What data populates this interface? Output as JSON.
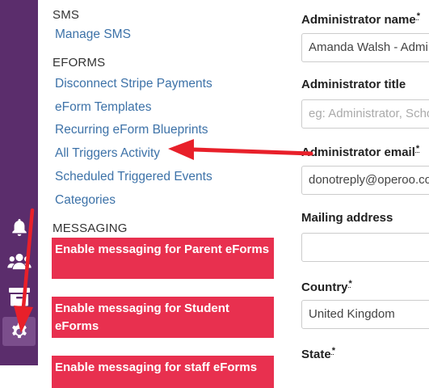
{
  "menu": {
    "sms_heading": "SMS",
    "manage_sms": "Manage SMS",
    "eforms_heading": "EFORMS",
    "eforms_links": [
      "Disconnect Stripe Payments",
      "eForm Templates",
      "Recurring eForm Blueprints",
      "All Triggers Activity",
      "Scheduled Triggered Events",
      "Categories"
    ],
    "messaging_heading": "MESSAGING",
    "messaging_buttons": [
      "Enable messaging for Parent eForms",
      "Enable messaging for Student eForms",
      "Enable messaging for staff eForms"
    ]
  },
  "form": {
    "admin_name_label": "Administrator name",
    "admin_name_value": "Amanda Walsh - Admin",
    "admin_title_label": "Administrator title",
    "admin_title_placeholder": "eg: Administrator, School Office",
    "admin_email_label": "Administrator email",
    "admin_email_value": "donotreply@operoo.com",
    "mailing_address_label": "Mailing address",
    "mailing_address_value": "",
    "country_label": "Country",
    "country_value": "United Kingdom",
    "state_label": "State",
    "required_mark": "*"
  },
  "sidebar_icons": [
    "bell-icon",
    "users-icon",
    "archive-icon",
    "gear-icon"
  ],
  "colors": {
    "sidebar": "#5b2d6c",
    "link": "#3d72a8",
    "button": "#e8304f",
    "arrow": "#e8202a"
  }
}
